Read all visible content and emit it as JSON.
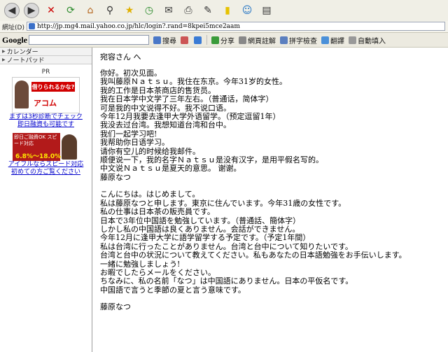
{
  "address": {
    "label": "網址(D)",
    "url": "http://jp.mg4.mail.yahoo.co.jp/hlc/login?.rand=8kpei5mce2aam"
  },
  "google_bar": {
    "logo": "Google",
    "items": [
      "搜尋",
      "分享",
      "網頁註解",
      "拼字檢查",
      "翻譯",
      "自動填入"
    ]
  },
  "sidebar": {
    "items": [
      "カレンダー",
      "ノートパッド"
    ],
    "pr_label": "PR",
    "ad1": {
      "banner": "借りられるかな?",
      "brand": "アコム",
      "link1": "まずは3秒診断でチェック",
      "link2": "即日融資も可能です"
    },
    "ad2": {
      "banner": "即日ご融資OK スピード対応",
      "rate": "6.8%～18.0%",
      "link1": "アイフルならスピード対応",
      "link2": "初めての方ご覧ください"
    }
  },
  "message": {
    "to": "宛容さん へ",
    "paragraph1": [
      "你好。初次见面。",
      "我叫藤原Ｎａｔｓｕ。我住在东京。今年31岁的女性。",
      "我的工作是日本茶商店的售货员。",
      "我在日本学中文学了三年左右。（普通话，简体字）",
      "可是我的中文说得不好。我不说口语。",
      "今年12月我要去逢甲大学外语留学。（预定逗留1年）",
      "我没去过台湾。我想知道台湾和台中。",
      "我们一起学习吧!",
      "我帮助你日语学习。",
      "请你有空儿的时候给我邮件。",
      "顺便说一下，我的名字Ｎａｔｓｕ是没有汉字，是用平假名写的。",
      "中文说Ｎａｔｓｕ是夏天的意思。                              谢谢。",
      "藤原なつ"
    ],
    "paragraph2": [
      "こんにちは。はじめまして。",
      "私は藤原なつと申します。東京に住んでいます。今年31歳の女性です。",
      "私の仕事は日本茶の販売員です。",
      "日本で3年位中国語を勉強しています。（普通話、簡体字）",
      "しかし私の中国語は良くありません。会話ができません。",
      "今年12月に逢甲大学に語学留学する予定です。（予定1年間）",
      "私は台湾に行ったことがありません。台湾と台中について知りたいです。",
      "台湾と台中の状況について教えてください。私もあなたの日本語勉強をお手伝いします。",
      "一緒に勉強しましょう!",
      "お暇でしたらメールをください。",
      "ちなみに、私の名前「なつ」は中国語にありません。日本の平仮名です。",
      "中国語で言うと季節の夏と言う意味です。"
    ],
    "signature": "藤原なつ"
  }
}
